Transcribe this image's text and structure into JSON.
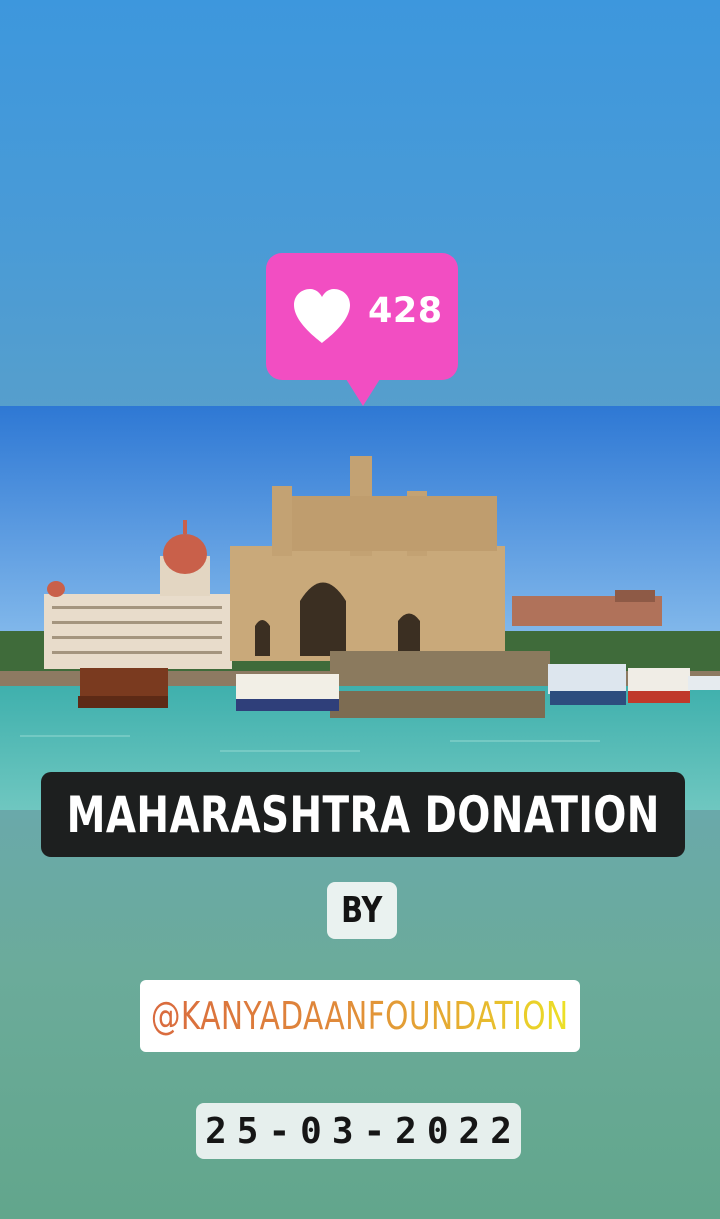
{
  "like_sticker": {
    "count": "428",
    "icon": "heart-icon",
    "color": "#f24ec2"
  },
  "title": "MAHARASHTRA DONATION",
  "by_label": "BY",
  "handle": "@KANYADAANFOUNDATION",
  "date": "25-03-2022"
}
